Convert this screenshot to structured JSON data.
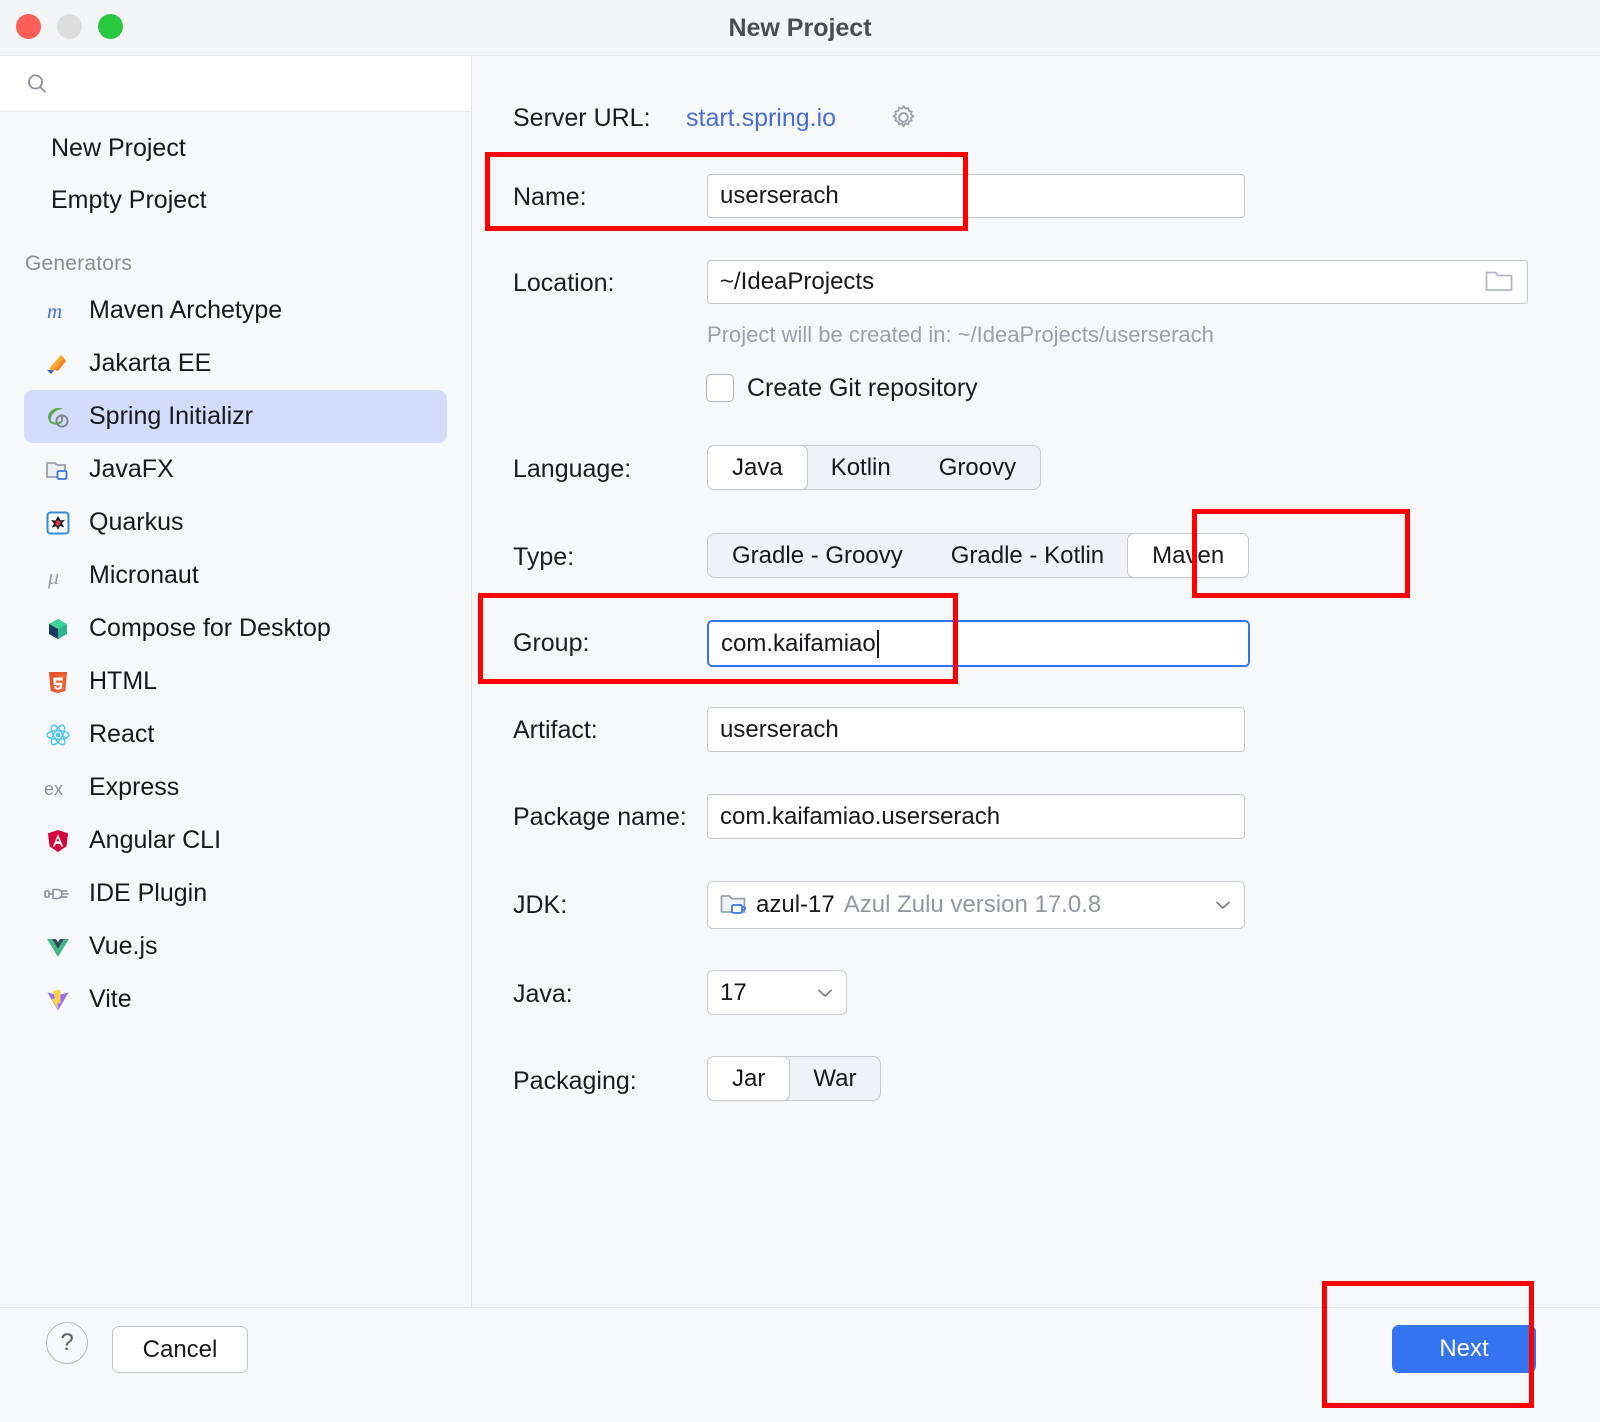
{
  "window": {
    "title": "New Project",
    "traffic_lights": [
      "close-button",
      "minimize-button",
      "zoom-button"
    ]
  },
  "sidebar": {
    "search": {
      "value": "",
      "placeholder": ""
    },
    "simple_items": [
      {
        "label": "New Project"
      },
      {
        "label": "Empty Project"
      }
    ],
    "section_label": "Generators",
    "generators": [
      {
        "label": "Maven Archetype",
        "icon": "maven-icon",
        "selected": false
      },
      {
        "label": "Jakarta EE",
        "icon": "jakarta-ee-icon",
        "selected": false
      },
      {
        "label": "Spring Initializr",
        "icon": "spring-icon",
        "selected": true
      },
      {
        "label": "JavaFX",
        "icon": "javafx-icon",
        "selected": false
      },
      {
        "label": "Quarkus",
        "icon": "quarkus-icon",
        "selected": false
      },
      {
        "label": "Micronaut",
        "icon": "micronaut-icon",
        "selected": false
      },
      {
        "label": "Compose for Desktop",
        "icon": "compose-icon",
        "selected": false
      },
      {
        "label": "HTML",
        "icon": "html5-icon",
        "selected": false
      },
      {
        "label": "React",
        "icon": "react-icon",
        "selected": false
      },
      {
        "label": "Express",
        "icon": "express-icon",
        "selected": false
      },
      {
        "label": "Angular CLI",
        "icon": "angular-icon",
        "selected": false
      },
      {
        "label": "IDE Plugin",
        "icon": "plugin-icon",
        "selected": false
      },
      {
        "label": "Vue.js",
        "icon": "vue-icon",
        "selected": false
      },
      {
        "label": "Vite",
        "icon": "vite-icon",
        "selected": false
      }
    ]
  },
  "form": {
    "server_url_label": "Server URL:",
    "server_url_value": "start.spring.io",
    "server_url_settings_icon": "gear-icon",
    "name_label": "Name:",
    "name_value": "userserach",
    "location_label": "Location:",
    "location_value": "~/IdeaProjects",
    "location_browse_icon": "folder-icon",
    "location_hint": "Project will be created in: ~/IdeaProjects/userserach",
    "git_label": "Create Git repository",
    "git_checked": false,
    "language_label": "Language:",
    "language_options": [
      "Java",
      "Kotlin",
      "Groovy"
    ],
    "language_selected": "Java",
    "type_label": "Type:",
    "type_options": [
      "Gradle - Groovy",
      "Gradle - Kotlin",
      "Maven"
    ],
    "type_selected": "Maven",
    "group_label": "Group:",
    "group_value": "com.kaifamiao",
    "group_focused": true,
    "artifact_label": "Artifact:",
    "artifact_value": "userserach",
    "package_label": "Package name:",
    "package_value": "com.kaifamiao.userserach",
    "jdk_label": "JDK:",
    "jdk_value": "azul-17",
    "jdk_detail": "Azul Zulu version 17.0.8",
    "jdk_icon": "jdk-folder-icon",
    "java_label": "Java:",
    "java_value": "17",
    "packaging_label": "Packaging:",
    "packaging_options": [
      "Jar",
      "War"
    ],
    "packaging_selected": "Jar"
  },
  "footer": {
    "help_label": "?",
    "cancel_label": "Cancel",
    "next_label": "Next"
  },
  "colors": {
    "accent_blue": "#3574f0",
    "link_blue": "#4a6fd1",
    "annotation_red": "#ff0000",
    "selection_blue": "#d3ddfb",
    "window_bg": "#f7f8fa"
  },
  "annotations": [
    {
      "name": "name-field-highlight"
    },
    {
      "name": "maven-type-highlight"
    },
    {
      "name": "group-field-highlight"
    },
    {
      "name": "next-button-highlight"
    }
  ]
}
